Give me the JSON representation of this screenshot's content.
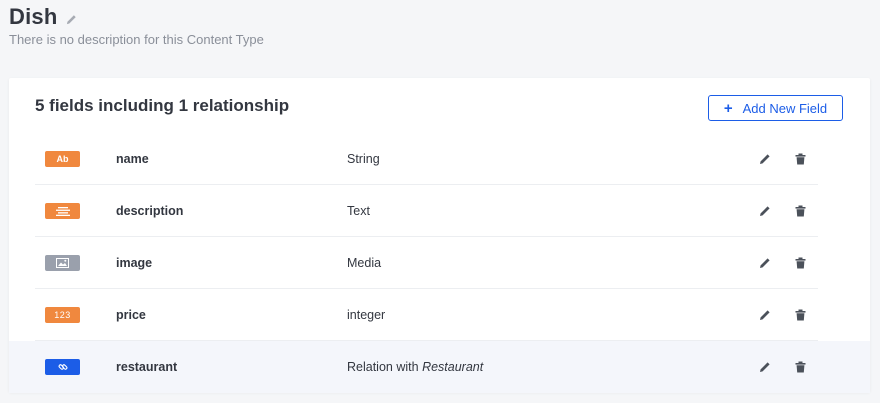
{
  "header": {
    "title": "Dish",
    "subtitle": "There is no description for this Content Type"
  },
  "card": {
    "summary": "5 fields including 1 relationship",
    "add_button_label": "Add New Field",
    "fields": [
      {
        "badge": "Ab",
        "badge_color": "#f0883e",
        "name": "name",
        "type": "String"
      },
      {
        "badge": "text-lines-icon",
        "badge_color": "#f0883e",
        "name": "description",
        "type": "Text"
      },
      {
        "badge": "image-icon",
        "badge_color": "#9aa0ac",
        "name": "image",
        "type": "Media"
      },
      {
        "badge": "123",
        "badge_color": "#f0883e",
        "name": "price",
        "type": "integer"
      },
      {
        "badge": "link-icon",
        "badge_color": "#1c5de7",
        "name": "restaurant",
        "type_prefix": "Relation with",
        "type_target": "Restaurant"
      }
    ]
  },
  "colors": {
    "accent": "#1c5de7",
    "badge_orange": "#f0883e",
    "badge_grey": "#9aa0ac",
    "icon": "#4b515a"
  }
}
